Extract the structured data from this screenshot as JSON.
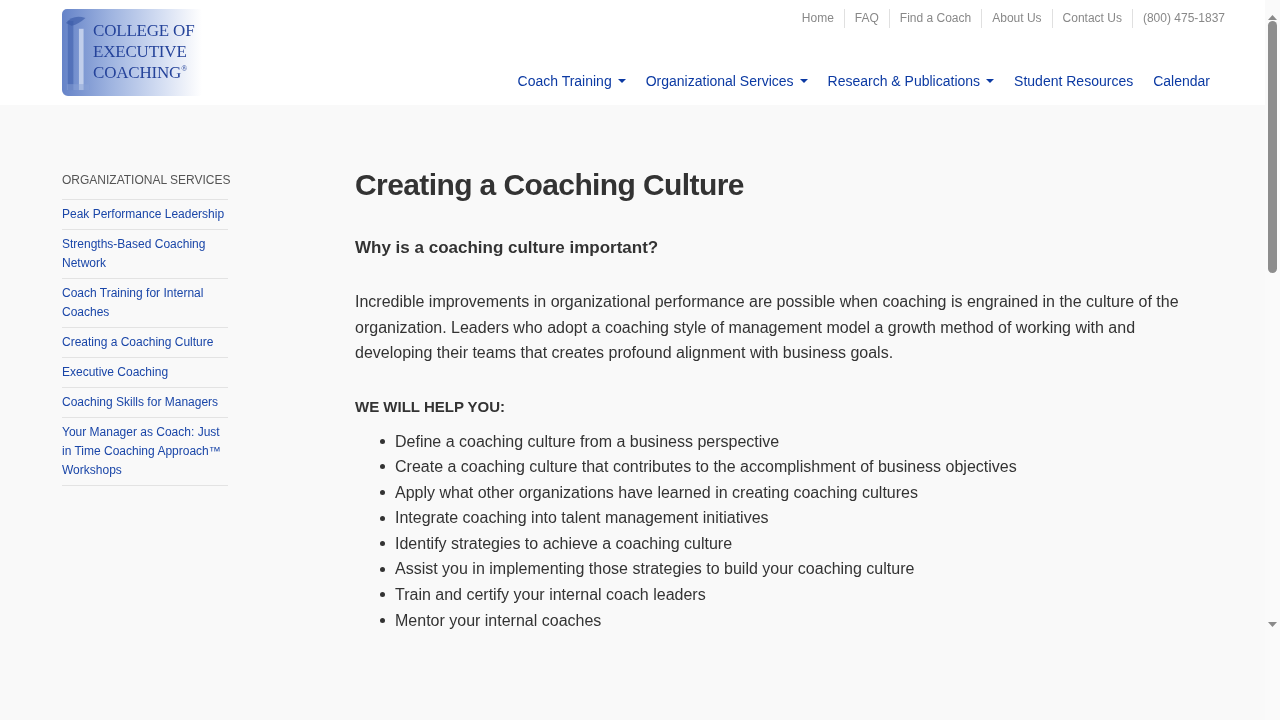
{
  "logo": {
    "lines": [
      "COLLEGE OF",
      "EXECUTIVE",
      "COACHING$^{®}$"
    ]
  },
  "top_links": [
    "Home",
    "FAQ",
    "Find a Coach",
    "About Us",
    "Contact Us",
    "(800) 475-1837"
  ],
  "main_nav": [
    {
      "label": "Coach Training",
      "dropdown": true
    },
    {
      "label": "Organizational Services",
      "dropdown": true
    },
    {
      "label": "Research & Publications",
      "dropdown": true
    },
    {
      "label": "Student Resources",
      "dropdown": false
    },
    {
      "label": "Calendar",
      "dropdown": false
    }
  ],
  "sidebar": {
    "heading": "ORGANIZATIONAL SERVICES",
    "items": [
      "Peak Performance Leadership",
      "Strengths-Based Coaching Network",
      "Coach Training for Internal Coaches",
      "Creating a Coaching Culture",
      "Executive Coaching",
      "Coaching Skills for Managers",
      "Your Manager as Coach: Just in Time Coaching Approach™ Workshops"
    ]
  },
  "article": {
    "title": "Creating a Coaching Culture",
    "subtitle": "Why is a coaching culture important?",
    "paragraph": "Incredible improvements in organizational performance are possible when coaching is engrained in the culture of the organization. Leaders who adopt a coaching style of management model a growth method of working with and developing their teams that creates profound alignment with business goals.",
    "list_heading": "WE WILL HELP YOU:",
    "list_items": [
      "Define a coaching culture from a business perspective",
      "Create a coaching culture that contributes to the accomplishment of business objectives",
      "Apply what other organizations have learned in creating coaching cultures",
      "Integrate coaching into talent management initiatives",
      "Identify strategies to achieve a coaching culture",
      "Assist you in implementing those strategies to build your coaching culture",
      "Train and certify your internal coach leaders",
      "Mentor your internal coaches"
    ]
  }
}
